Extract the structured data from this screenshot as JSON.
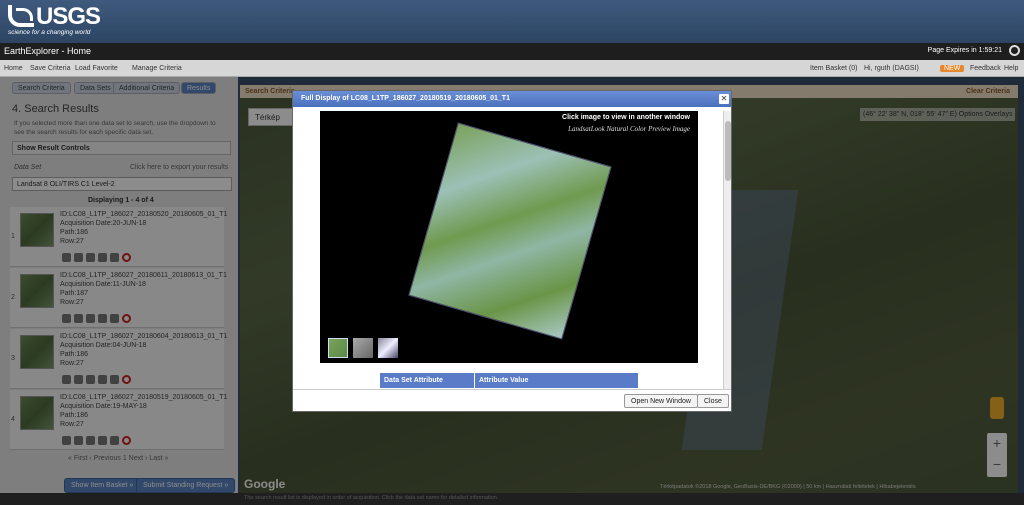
{
  "logo": {
    "name": "USGS",
    "tagline": "science for a changing world"
  },
  "app": {
    "title": "EarthExplorer - Home",
    "expires": "Page Expires in 1:59:21"
  },
  "nav": {
    "home": "Home",
    "saved": "Save Criteria",
    "favorites": "Load Favorite",
    "manage": "Manage Criteria",
    "basket": "Item Basket (0)",
    "user": "Hi, rguth (DAGSI)",
    "feedback": "Feedback",
    "help": "Help",
    "badge": "NEW"
  },
  "tabs": [
    "Search Criteria",
    "Data Sets",
    "Additional Criteria",
    "Results"
  ],
  "results": {
    "title": "4. Search Results",
    "desc": "If you selected more than one data set to search, use the dropdown to see the search results for each specific data set.",
    "controls": "Show Result Controls",
    "dataset_label": "Data Set",
    "export": "Click here to export your results",
    "dataset": "Landsat 8 OLI/TIRS C1 Level-2",
    "displaying": "Displaying 1 - 4 of 4",
    "items": [
      {
        "num": "1",
        "id": "ID:LC08_L1TP_186027_20180520_20180605_01_T1",
        "date": "Acquisition Date:20-JUN-18",
        "path": "Path:186",
        "row": "Row:27"
      },
      {
        "num": "2",
        "id": "ID:LC08_L1TP_186027_20180611_20180613_01_T1",
        "date": "Acquisition Date:11-JUN-18",
        "path": "Path:187",
        "row": "Row:27"
      },
      {
        "num": "3",
        "id": "ID:LC08_L1TP_186027_20180604_20180613_01_T1",
        "date": "Acquisition Date:04-JUN-18",
        "path": "Path:186",
        "row": "Row:27"
      },
      {
        "num": "4",
        "id": "ID:LC08_L1TP_186027_20180519_20180605_01_T1",
        "date": "Acquisition Date:19-MAY-18",
        "path": "Path:186",
        "row": "Row:27"
      }
    ],
    "pager": "« First  ‹ Previous  1  Next ›  Last »",
    "btn_prev": "Show Item Basket »",
    "btn_next": "Submit Standing Request »"
  },
  "map": {
    "search_criteria": "Search Criteria",
    "clear": "Clear Criteria",
    "terkep": "Térkép",
    "coords": "(46° 22' 38\" N, 018° 55' 47\" E)",
    "options": "Options",
    "overlays": "Overlays",
    "google": "Google",
    "attrib": "Térképadatok ©2018 Google, GeoBasis-DE/BKG (©2009) | 50 km | Használati feltételek | Hibabejelentés"
  },
  "footer": "The search result list is displayed in order of acquisition. Click the data set name for detailed information.",
  "modal": {
    "title": "Full Display of LC08_L1TP_186027_20180519_20180605_01_T1",
    "click_text": "Click image to view in another window",
    "subtitle": "LandsatLook Natural Color Preview Image",
    "attr_col": "Data Set Attribute",
    "val_col": "Attribute Value",
    "open_btn": "Open New Window",
    "close_btn": "Close"
  }
}
